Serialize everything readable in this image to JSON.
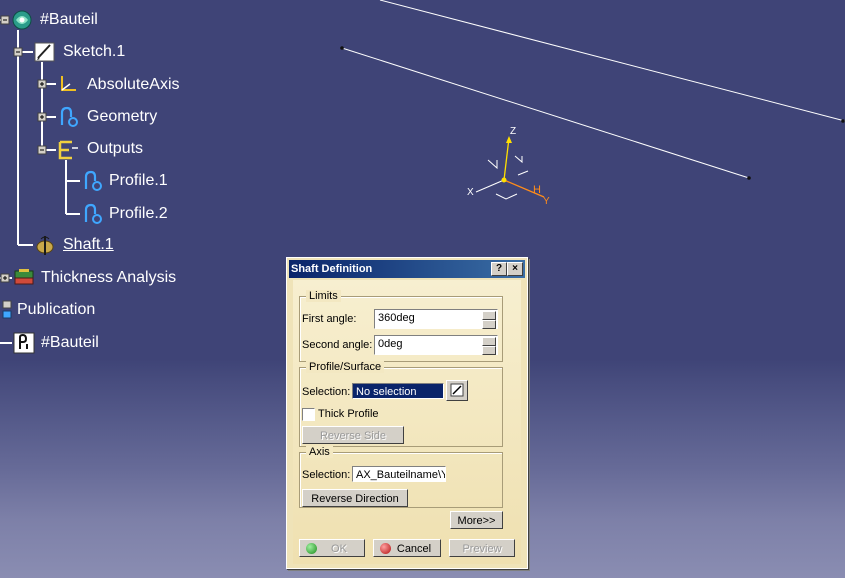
{
  "tree": {
    "items": [
      {
        "label": "#Bauteil",
        "icon": "part-icon"
      },
      {
        "label": "Sketch.1",
        "icon": "sketch-icon"
      },
      {
        "label": "AbsoluteAxis",
        "icon": "axis-icon"
      },
      {
        "label": "Geometry",
        "icon": "geometry-icon"
      },
      {
        "label": "Outputs",
        "icon": "outputs-icon"
      },
      {
        "label": "Profile.1",
        "icon": "profile-icon"
      },
      {
        "label": "Profile.2",
        "icon": "profile-icon"
      },
      {
        "label": "Shaft.1",
        "icon": "shaft-icon"
      },
      {
        "label": "Thickness Analysis",
        "icon": "analysis-icon"
      },
      {
        "label": "Publication",
        "icon": "publication-icon"
      },
      {
        "label": "#Bauteil",
        "icon": "parameter-icon"
      }
    ]
  },
  "compass": {
    "z": "Z",
    "x": "X",
    "y": "Y",
    "h": "H"
  },
  "dialog": {
    "title": "Shaft Definition",
    "help_glyph": "?",
    "close_glyph": "×",
    "limits": {
      "title": "Limits",
      "first_label": "First angle:",
      "first_value": "360deg",
      "second_label": "Second angle:",
      "second_value": "0deg"
    },
    "profile": {
      "title": "Profile/Surface",
      "selection_label": "Selection:",
      "selection_value": "No selection",
      "thick_label": "Thick Profile",
      "reverse_side": "Reverse Side"
    },
    "axis": {
      "title": "Axis",
      "selection_label": "Selection:",
      "selection_value": "AX_Bauteilname\\Y",
      "reverse_direction": "Reverse Direction"
    },
    "more": "More>>",
    "ok": "OK",
    "cancel": "Cancel",
    "preview": "Preview"
  },
  "colors": {
    "background": "#3f4477",
    "title_bar": "#0a246a",
    "dialog_bg": "#efe3b8",
    "selection_highlight": "#0a246a",
    "compass_y": "#ff8c1a",
    "compass_z": "#ffe000"
  }
}
